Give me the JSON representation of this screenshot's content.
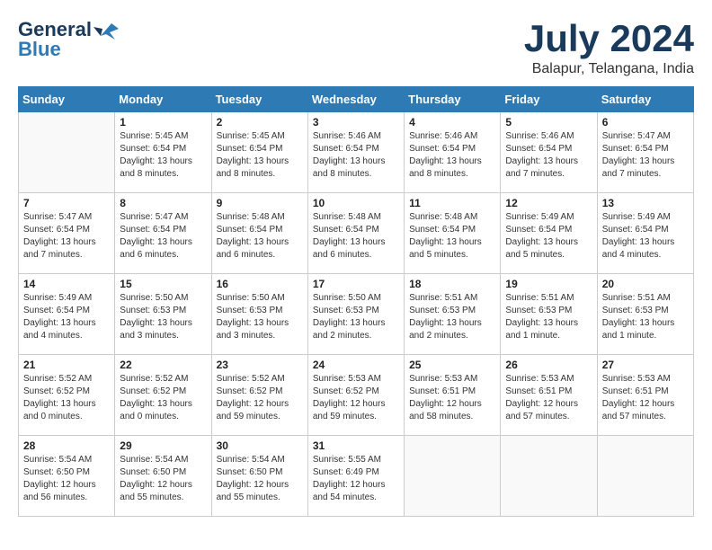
{
  "header": {
    "logo_general": "General",
    "logo_blue": "Blue",
    "month_title": "July 2024",
    "location": "Balapur, Telangana, India"
  },
  "days_of_week": [
    "Sunday",
    "Monday",
    "Tuesday",
    "Wednesday",
    "Thursday",
    "Friday",
    "Saturday"
  ],
  "weeks": [
    [
      {
        "day": "",
        "info": ""
      },
      {
        "day": "1",
        "info": "Sunrise: 5:45 AM\nSunset: 6:54 PM\nDaylight: 13 hours\nand 8 minutes."
      },
      {
        "day": "2",
        "info": "Sunrise: 5:45 AM\nSunset: 6:54 PM\nDaylight: 13 hours\nand 8 minutes."
      },
      {
        "day": "3",
        "info": "Sunrise: 5:46 AM\nSunset: 6:54 PM\nDaylight: 13 hours\nand 8 minutes."
      },
      {
        "day": "4",
        "info": "Sunrise: 5:46 AM\nSunset: 6:54 PM\nDaylight: 13 hours\nand 8 minutes."
      },
      {
        "day": "5",
        "info": "Sunrise: 5:46 AM\nSunset: 6:54 PM\nDaylight: 13 hours\nand 7 minutes."
      },
      {
        "day": "6",
        "info": "Sunrise: 5:47 AM\nSunset: 6:54 PM\nDaylight: 13 hours\nand 7 minutes."
      }
    ],
    [
      {
        "day": "7",
        "info": "Sunrise: 5:47 AM\nSunset: 6:54 PM\nDaylight: 13 hours\nand 7 minutes."
      },
      {
        "day": "8",
        "info": "Sunrise: 5:47 AM\nSunset: 6:54 PM\nDaylight: 13 hours\nand 6 minutes."
      },
      {
        "day": "9",
        "info": "Sunrise: 5:48 AM\nSunset: 6:54 PM\nDaylight: 13 hours\nand 6 minutes."
      },
      {
        "day": "10",
        "info": "Sunrise: 5:48 AM\nSunset: 6:54 PM\nDaylight: 13 hours\nand 6 minutes."
      },
      {
        "day": "11",
        "info": "Sunrise: 5:48 AM\nSunset: 6:54 PM\nDaylight: 13 hours\nand 5 minutes."
      },
      {
        "day": "12",
        "info": "Sunrise: 5:49 AM\nSunset: 6:54 PM\nDaylight: 13 hours\nand 5 minutes."
      },
      {
        "day": "13",
        "info": "Sunrise: 5:49 AM\nSunset: 6:54 PM\nDaylight: 13 hours\nand 4 minutes."
      }
    ],
    [
      {
        "day": "14",
        "info": "Sunrise: 5:49 AM\nSunset: 6:54 PM\nDaylight: 13 hours\nand 4 minutes."
      },
      {
        "day": "15",
        "info": "Sunrise: 5:50 AM\nSunset: 6:53 PM\nDaylight: 13 hours\nand 3 minutes."
      },
      {
        "day": "16",
        "info": "Sunrise: 5:50 AM\nSunset: 6:53 PM\nDaylight: 13 hours\nand 3 minutes."
      },
      {
        "day": "17",
        "info": "Sunrise: 5:50 AM\nSunset: 6:53 PM\nDaylight: 13 hours\nand 2 minutes."
      },
      {
        "day": "18",
        "info": "Sunrise: 5:51 AM\nSunset: 6:53 PM\nDaylight: 13 hours\nand 2 minutes."
      },
      {
        "day": "19",
        "info": "Sunrise: 5:51 AM\nSunset: 6:53 PM\nDaylight: 13 hours\nand 1 minute."
      },
      {
        "day": "20",
        "info": "Sunrise: 5:51 AM\nSunset: 6:53 PM\nDaylight: 13 hours\nand 1 minute."
      }
    ],
    [
      {
        "day": "21",
        "info": "Sunrise: 5:52 AM\nSunset: 6:52 PM\nDaylight: 13 hours\nand 0 minutes."
      },
      {
        "day": "22",
        "info": "Sunrise: 5:52 AM\nSunset: 6:52 PM\nDaylight: 13 hours\nand 0 minutes."
      },
      {
        "day": "23",
        "info": "Sunrise: 5:52 AM\nSunset: 6:52 PM\nDaylight: 12 hours\nand 59 minutes."
      },
      {
        "day": "24",
        "info": "Sunrise: 5:53 AM\nSunset: 6:52 PM\nDaylight: 12 hours\nand 59 minutes."
      },
      {
        "day": "25",
        "info": "Sunrise: 5:53 AM\nSunset: 6:51 PM\nDaylight: 12 hours\nand 58 minutes."
      },
      {
        "day": "26",
        "info": "Sunrise: 5:53 AM\nSunset: 6:51 PM\nDaylight: 12 hours\nand 57 minutes."
      },
      {
        "day": "27",
        "info": "Sunrise: 5:53 AM\nSunset: 6:51 PM\nDaylight: 12 hours\nand 57 minutes."
      }
    ],
    [
      {
        "day": "28",
        "info": "Sunrise: 5:54 AM\nSunset: 6:50 PM\nDaylight: 12 hours\nand 56 minutes."
      },
      {
        "day": "29",
        "info": "Sunrise: 5:54 AM\nSunset: 6:50 PM\nDaylight: 12 hours\nand 55 minutes."
      },
      {
        "day": "30",
        "info": "Sunrise: 5:54 AM\nSunset: 6:50 PM\nDaylight: 12 hours\nand 55 minutes."
      },
      {
        "day": "31",
        "info": "Sunrise: 5:55 AM\nSunset: 6:49 PM\nDaylight: 12 hours\nand 54 minutes."
      },
      {
        "day": "",
        "info": ""
      },
      {
        "day": "",
        "info": ""
      },
      {
        "day": "",
        "info": ""
      }
    ]
  ]
}
